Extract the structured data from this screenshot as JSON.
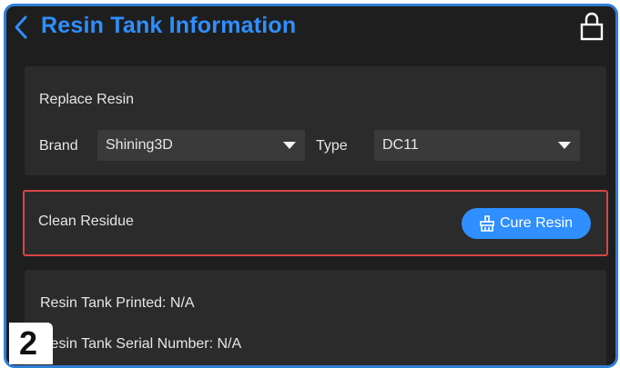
{
  "header": {
    "title": "Resin Tank Information",
    "back_icon": "chevron-left-icon",
    "right_icon": "lock-icon"
  },
  "replace_resin": {
    "title": "Replace Resin",
    "brand_label": "Brand",
    "brand_value": "Shining3D",
    "type_label": "Type",
    "type_value": "DC11"
  },
  "clean_residue": {
    "label": "Clean Residue",
    "button_label": "Cure Resin",
    "button_icon": "broom-icon"
  },
  "info": {
    "printed": "Resin Tank Printed: N/A",
    "serial": "Resin Tank Serial Number: N/A"
  },
  "step_badge": "2",
  "colors": {
    "accent": "#2f8fff",
    "background": "#1e1e1e",
    "card": "#2b2b2b",
    "highlight_border": "#d64545"
  }
}
